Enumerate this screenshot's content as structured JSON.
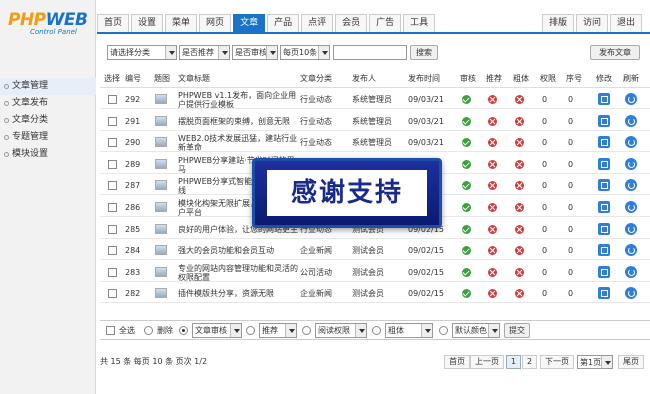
{
  "logo": {
    "brand_main": "PHP",
    "brand_accent": "WEB",
    "sub": "Control Panel"
  },
  "sidebar": {
    "items": [
      {
        "label": "文章管理"
      },
      {
        "label": "文章发布"
      },
      {
        "label": "文章分类"
      },
      {
        "label": "专题管理"
      },
      {
        "label": "模块设置"
      }
    ]
  },
  "tabs": [
    {
      "label": "首页"
    },
    {
      "label": "设置"
    },
    {
      "label": "菜单"
    },
    {
      "label": "网页"
    },
    {
      "label": "文章"
    },
    {
      "label": "产品"
    },
    {
      "label": "点评"
    },
    {
      "label": "会员"
    },
    {
      "label": "广告"
    },
    {
      "label": "工具"
    }
  ],
  "right_tabs": [
    {
      "label": "排版"
    },
    {
      "label": "访问"
    },
    {
      "label": "退出"
    }
  ],
  "filters": {
    "category": "请选择分类",
    "recommend": "是否推荐",
    "audit": "是否审核",
    "per_page": "每页10条",
    "search_button": "搜索",
    "publish_button": "发布文章"
  },
  "table": {
    "headers": {
      "select": "选择",
      "id": "编号",
      "image": "题图",
      "title": "文章标题",
      "category": "文章分类",
      "publisher": "发布人",
      "time": "发布时间",
      "audit": "审核",
      "recommend": "推荐",
      "bold": "粗体",
      "permission": "权限",
      "order": "序号",
      "edit": "修改",
      "refresh": "刷新"
    },
    "rows": [
      {
        "id": "292",
        "title": "PHPWEB v1.1发布，面向企业用户提供行业模板",
        "category": "行业动态",
        "publisher": "系统管理员",
        "time": "09/03/21",
        "perm": "0",
        "order": "0"
      },
      {
        "id": "291",
        "title": "摆脱页面框架的束缚，创意无限",
        "category": "行业动态",
        "publisher": "系统管理员",
        "time": "09/03/21",
        "perm": "0",
        "order": "0"
      },
      {
        "id": "290",
        "title": "WEB2.0技术发展迅猛，建站行业新革命",
        "category": "行业动态",
        "publisher": "系统管理员",
        "time": "09/03/21",
        "perm": "0",
        "order": "0"
      },
      {
        "id": "289",
        "title": "PHPWEB分享建站·节省时间的果马",
        "category": "",
        "publisher": "",
        "time": "21",
        "perm": "0",
        "order": "0"
      },
      {
        "id": "287",
        "title": "PHPWEB分享式智能建站系统上线",
        "category": "",
        "publisher": "",
        "time": "15",
        "perm": "0",
        "order": "0"
      },
      {
        "id": "286",
        "title": "模块化构架无限扩展，打造真正门户平台",
        "category": "",
        "publisher": "",
        "time": "15",
        "perm": "0",
        "order": "0"
      },
      {
        "id": "285",
        "title": "良好的用户体验，让您的网站更主动",
        "category": "行业动态",
        "publisher": "测试会员",
        "time": "09/02/15",
        "perm": "0",
        "order": "0"
      },
      {
        "id": "284",
        "title": "强大的会员功能和会员互动",
        "category": "企业新闻",
        "publisher": "测试会员",
        "time": "09/02/15",
        "perm": "0",
        "order": "0"
      },
      {
        "id": "283",
        "title": "专业的网站内容管理功能和灵活的权限配置",
        "category": "公司活动",
        "publisher": "测试会员",
        "time": "09/02/15",
        "perm": "0",
        "order": "0"
      },
      {
        "id": "282",
        "title": "插件模版共分享，资源无限",
        "category": "企业新闻",
        "publisher": "测试会员",
        "time": "09/02/15",
        "perm": "0",
        "order": "0"
      }
    ]
  },
  "bulk": {
    "select_all": "全选",
    "delete": "删除",
    "audit": "文章审核",
    "recommend": "推荐",
    "permission": "阅读权限",
    "bold": "粗体",
    "color": "默认颜色",
    "submit": "提交"
  },
  "footer": {
    "summary": "共 15 条  每页 10 条  页次 1/2",
    "first": "首页",
    "prev": "上一页",
    "page1": "1",
    "page2": "2",
    "next": "下一页",
    "page_select": "第1页",
    "last": "尾页"
  },
  "overlay": {
    "text": "感谢支持"
  }
}
